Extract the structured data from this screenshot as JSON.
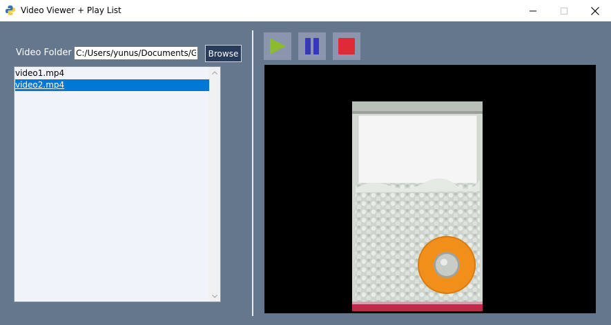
{
  "window": {
    "title": "Video Viewer + Play List",
    "icon": "python-icon"
  },
  "controls": {
    "minimize_icon": "minimize-icon",
    "maximize_icon": "maximize-icon",
    "close_icon": "close-icon"
  },
  "folder": {
    "label": "Video Folder",
    "value": "C:/Users/yunus/Documents/Gi",
    "browse_label": "Browse"
  },
  "playlist": {
    "items": [
      {
        "name": "video1.mp4",
        "selected": false
      },
      {
        "name": "video2.mp4",
        "selected": true
      }
    ]
  },
  "player": {
    "buttons": [
      {
        "icon": "play-icon",
        "color": "#8dbb2e"
      },
      {
        "icon": "pause-icon",
        "color": "#3737bb"
      },
      {
        "icon": "stop-icon",
        "color": "#e02a35"
      }
    ],
    "frame": "video-frame-bag-of-beads-with-coin"
  },
  "colors": {
    "background": "#64778d",
    "button_background": "#8b95ad",
    "browse_button": "#283b5b",
    "selection": "#0078d7",
    "list_background": "#f0f4fa",
    "video_background": "#000000"
  }
}
